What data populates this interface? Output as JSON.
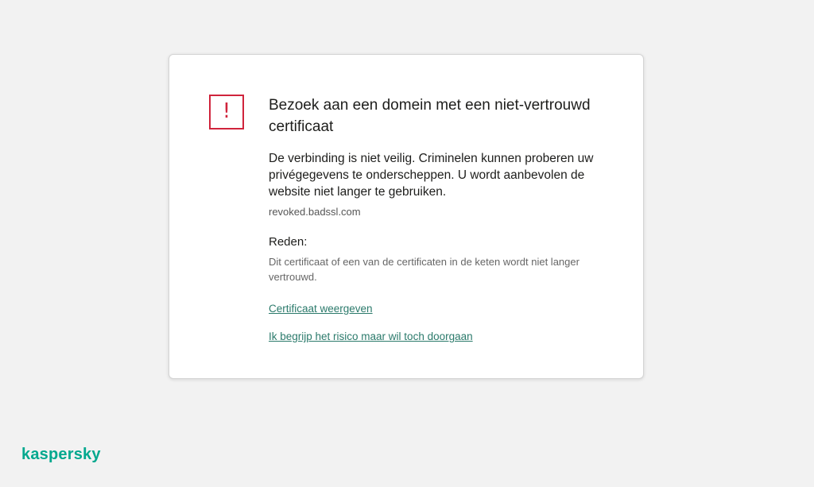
{
  "warning": {
    "icon_name": "exclamation-warning-icon",
    "icon_glyph": "!",
    "title": "Bezoek aan een domein met een niet-vertrouwd certificaat",
    "lead": "De verbinding is niet veilig. Criminelen kunnen proberen uw privégegevens te onderscheppen. U wordt aanbevolen de website niet langer te gebruiken.",
    "domain": "revoked.badssl.com",
    "reason_heading": "Reden:",
    "reason_text": "Dit certificaat of een van de certificaten in de keten wordt niet langer vertrouwd."
  },
  "links": {
    "view_certificate": "Certificaat weergeven",
    "proceed_anyway": "Ik begrijp het risico maar wil toch doorgaan"
  },
  "brand": {
    "logo_text": "kaspersky",
    "accent_color": "#00a88e",
    "warning_color": "#d0243c",
    "link_color": "#2b7a6b"
  }
}
